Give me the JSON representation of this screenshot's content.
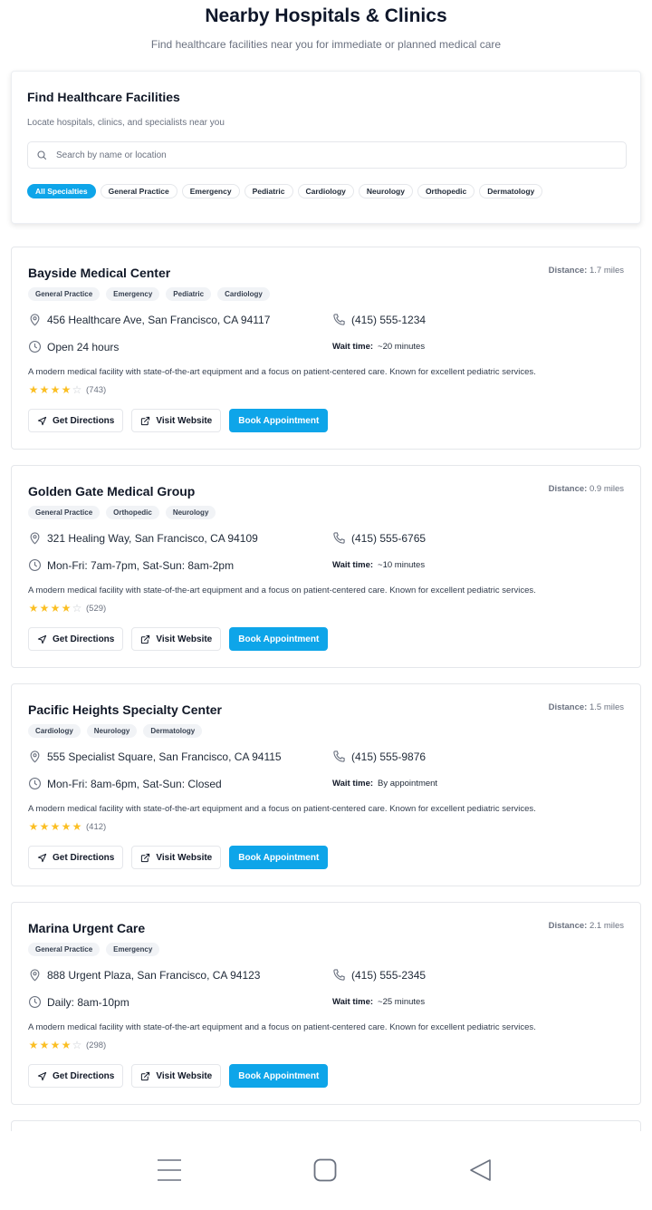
{
  "header": {
    "title": "Nearby Hospitals & Clinics",
    "subtitle": "Find healthcare facilities near you for immediate or planned medical care"
  },
  "search": {
    "title": "Find Healthcare Facilities",
    "subtitle": "Locate hospitals, clinics, and specialists near you",
    "placeholder": "Search by name or location",
    "icon": "search-icon",
    "filters": [
      {
        "label": "All Specialties",
        "active": true
      },
      {
        "label": "General Practice",
        "active": false
      },
      {
        "label": "Emergency",
        "active": false
      },
      {
        "label": "Pediatric",
        "active": false
      },
      {
        "label": "Cardiology",
        "active": false
      },
      {
        "label": "Neurology",
        "active": false
      },
      {
        "label": "Orthopedic",
        "active": false
      },
      {
        "label": "Dermatology",
        "active": false
      }
    ]
  },
  "labels": {
    "distance": "Distance:",
    "wait_time": "Wait time:",
    "get_directions": "Get Directions",
    "visit_website": "Visit Website",
    "book_appointment": "Book Appointment"
  },
  "facilities": [
    {
      "name": "Bayside Medical Center",
      "distance": "1.7 miles",
      "tags": [
        "General Practice",
        "Emergency",
        "Pediatric",
        "Cardiology"
      ],
      "address": "456 Healthcare Ave, San Francisco, CA 94117",
      "phone": "(415) 555-1234",
      "hours": "Open 24 hours",
      "wait": "~20 minutes",
      "description": "A modern medical facility with state-of-the-art equipment and a focus on patient-centered care. Known for excellent pediatric services.",
      "rating": 4,
      "reviews": "(743)"
    },
    {
      "name": "Golden Gate Medical Group",
      "distance": "0.9 miles",
      "tags": [
        "General Practice",
        "Orthopedic",
        "Neurology"
      ],
      "address": "321 Healing Way, San Francisco, CA 94109",
      "phone": "(415) 555-6765",
      "hours": "Mon-Fri: 7am-7pm, Sat-Sun: 8am-2pm",
      "wait": "~10 minutes",
      "description": "A modern medical facility with state-of-the-art equipment and a focus on patient-centered care. Known for excellent pediatric services.",
      "rating": 4,
      "reviews": "(529)"
    },
    {
      "name": "Pacific Heights Specialty Center",
      "distance": "1.5 miles",
      "tags": [
        "Cardiology",
        "Neurology",
        "Dermatology"
      ],
      "address": "555 Specialist Square, San Francisco, CA 94115",
      "phone": "(415) 555-9876",
      "hours": "Mon-Fri: 8am-6pm, Sat-Sun: Closed",
      "wait": "By appointment",
      "description": "A modern medical facility with state-of-the-art equipment and a focus on patient-centered care. Known for excellent pediatric services.",
      "rating": 5,
      "reviews": "(412)"
    },
    {
      "name": "Marina Urgent Care",
      "distance": "2.1 miles",
      "tags": [
        "General Practice",
        "Emergency"
      ],
      "address": "888 Urgent Plaza, San Francisco, CA 94123",
      "phone": "(415) 555-2345",
      "hours": "Daily: 8am-10pm",
      "wait": "~25 minutes",
      "description": "A modern medical facility with state-of-the-art equipment and a focus on patient-centered care. Known for excellent pediatric services.",
      "rating": 4,
      "reviews": "(298)"
    }
  ],
  "colors": {
    "accent": "#0ea5e9",
    "star": "#fbbf24"
  },
  "system_nav": {
    "icons": [
      "menu-icon",
      "home-icon",
      "back-icon"
    ]
  }
}
